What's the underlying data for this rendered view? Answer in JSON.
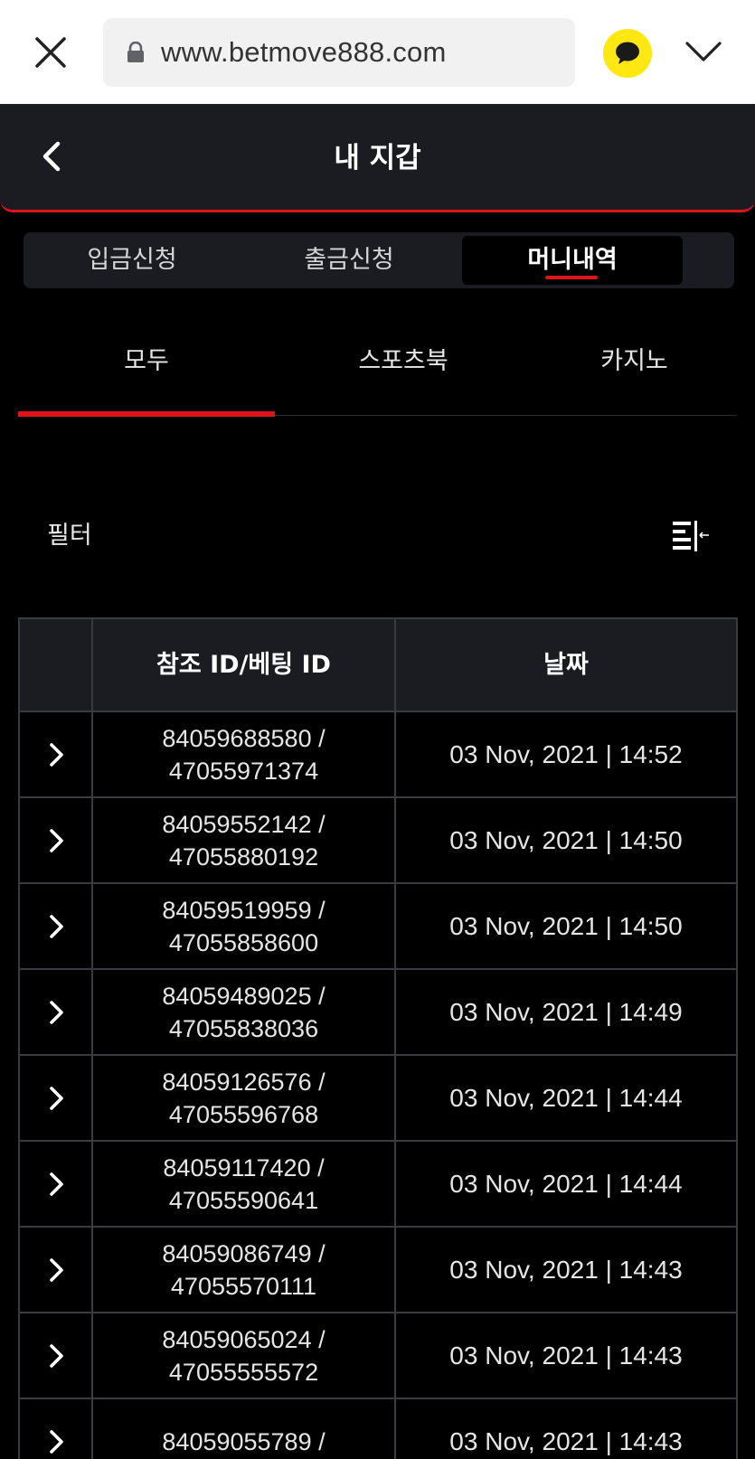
{
  "browser": {
    "url": "www.betmove888.com"
  },
  "header": {
    "title": "내 지갑"
  },
  "segments": [
    {
      "label": "입금신청"
    },
    {
      "label": "출금신청"
    },
    {
      "label": "머니내역",
      "active": true
    }
  ],
  "categories": [
    {
      "label": "모두",
      "active": true
    },
    {
      "label": "스포츠북"
    },
    {
      "label": "카지노"
    }
  ],
  "filter": {
    "label": "필터"
  },
  "table": {
    "headers": [
      "",
      "참조 ID/베팅 ID",
      "날짜"
    ],
    "rows": [
      {
        "ref_id": "84059688580 /",
        "bet_id": "47055971374",
        "date": "03 Nov, 2021 | 14:52"
      },
      {
        "ref_id": "84059552142 /",
        "bet_id": "47055880192",
        "date": "03 Nov, 2021 | 14:50"
      },
      {
        "ref_id": "84059519959 /",
        "bet_id": "47055858600",
        "date": "03 Nov, 2021 | 14:50"
      },
      {
        "ref_id": "84059489025 /",
        "bet_id": "47055838036",
        "date": "03 Nov, 2021 | 14:49"
      },
      {
        "ref_id": "84059126576 /",
        "bet_id": "47055596768",
        "date": "03 Nov, 2021 | 14:44"
      },
      {
        "ref_id": "84059117420 /",
        "bet_id": "47055590641",
        "date": "03 Nov, 2021 | 14:44"
      },
      {
        "ref_id": "84059086749 /",
        "bet_id": "47055570111",
        "date": "03 Nov, 2021 | 14:43"
      },
      {
        "ref_id": "84059065024 /",
        "bet_id": "47055555572",
        "date": "03 Nov, 2021 | 14:43"
      },
      {
        "ref_id": "84059055789 /",
        "bet_id": "",
        "date": "03 Nov, 2021 | 14:43"
      }
    ]
  },
  "icons": {
    "close": "close-icon",
    "lock": "lock-icon",
    "kakao": "kakaotalk-icon",
    "menu": "chevron-down-icon",
    "back": "chevron-left-icon",
    "filter": "filter-collapse-icon",
    "row_expand": "chevron-right-icon"
  },
  "colors": {
    "accent": "#e0131a",
    "header_bg": "#1b1c22",
    "page_bg": "#000000",
    "kakao_yellow": "#ffe812"
  }
}
